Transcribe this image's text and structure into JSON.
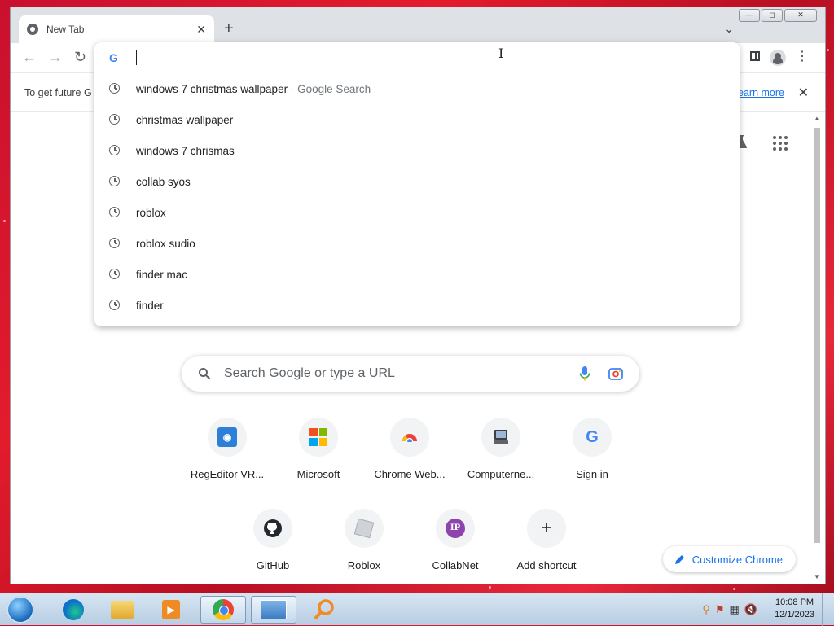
{
  "browser": {
    "tab": {
      "title": "New Tab",
      "close": "✕"
    },
    "new_tab_label": "+",
    "window_controls": {
      "minimize": "—",
      "maximize": "◻",
      "close": "✕"
    },
    "infobar": {
      "text": "To get future G",
      "link": "Learn more",
      "close": "✕"
    }
  },
  "omnibox": {
    "value": "",
    "suggestions": [
      {
        "text": "windows 7 christmas wallpaper",
        "sub": " - Google Search"
      },
      {
        "text": "christmas wallpaper",
        "sub": ""
      },
      {
        "text": "windows 7 chrismas",
        "sub": ""
      },
      {
        "text": "collab syos",
        "sub": ""
      },
      {
        "text": "roblox",
        "sub": ""
      },
      {
        "text": "roblox sudio",
        "sub": ""
      },
      {
        "text": "finder mac",
        "sub": ""
      },
      {
        "text": "finder",
        "sub": ""
      }
    ]
  },
  "ntp": {
    "search_placeholder": "Search Google or type a URL",
    "shortcuts": [
      {
        "label": "RegEditor VR...",
        "icon": "regeditor-icon"
      },
      {
        "label": "Microsoft",
        "icon": "microsoft-icon"
      },
      {
        "label": "Chrome Web...",
        "icon": "chrome-web-store-icon"
      },
      {
        "label": "Computerne...",
        "icon": "computernewb-icon"
      },
      {
        "label": "Sign in",
        "icon": "google-icon"
      },
      {
        "label": "GitHub",
        "icon": "github-icon"
      },
      {
        "label": "Roblox",
        "icon": "roblox-icon"
      },
      {
        "label": "CollabNet",
        "icon": "collabnet-icon",
        "letter": "IP"
      },
      {
        "label": "Add shortcut",
        "icon": "add-icon",
        "letter": "+"
      }
    ],
    "customize_label": "Customize Chrome"
  },
  "taskbar": {
    "time": "10:08 PM",
    "date": "12/1/2023"
  },
  "colors": {
    "accent": "#1a73e8",
    "desktop": "#d01428"
  }
}
